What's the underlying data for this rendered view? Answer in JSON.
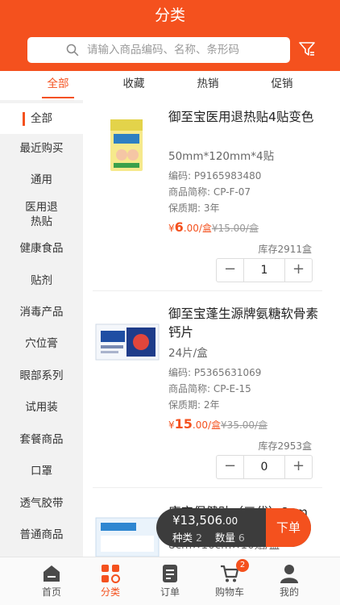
{
  "header": {
    "title": "分类"
  },
  "search": {
    "placeholder": "请输入商品编码、名称、条形码",
    "icon": "search-icon"
  },
  "top_tabs": [
    {
      "label": "全部",
      "active": true
    },
    {
      "label": "收藏"
    },
    {
      "label": "热销"
    },
    {
      "label": "促销"
    }
  ],
  "sidebar": {
    "items": [
      {
        "label": "全部",
        "active": true
      },
      {
        "label": "最近购买"
      },
      {
        "label": "通用"
      },
      {
        "label": "医用退热贴"
      },
      {
        "label": "健康食品"
      },
      {
        "label": "贴剂"
      },
      {
        "label": "消毒产品"
      },
      {
        "label": "穴位膏"
      },
      {
        "label": "眼部系列"
      },
      {
        "label": "试用装"
      },
      {
        "label": "套餐商品"
      },
      {
        "label": "口罩"
      },
      {
        "label": "透气胶带"
      },
      {
        "label": "普通商品"
      }
    ]
  },
  "products": [
    {
      "name": "御至宝医用退热贴4贴变色",
      "spec": "50mm*120mm*4贴",
      "code": "编码: P9165983480",
      "short_name": "商品简称: CP-F-07",
      "shelf_life": "保质期: 3年",
      "price_symbol": "¥",
      "price_int": "6",
      "price_dec": ".00",
      "price_unit": "/盒",
      "old_price": "¥15.00/盒",
      "stock": "库存2911盒",
      "qty": "1"
    },
    {
      "name": "御至宝蓬生源牌氨糖软骨素钙片",
      "spec": "24片/盒",
      "code": "编码: P5365631069",
      "short_name": "商品简称: CP-E-15",
      "shelf_life": "保质期: 2年",
      "price_symbol": "¥",
      "price_int": "15",
      "price_dec": ".00",
      "price_unit": "/盒",
      "old_price": "¥35.00/盒",
      "stock": "库存2953盒",
      "qty": "0"
    },
    {
      "name": "康宝保健贴（三代）8cm",
      "spec": "8cm×10cm×10贴/盒"
    }
  ],
  "cart": {
    "total_symbol": "¥",
    "total_int": "13,506",
    "total_dec": ".00",
    "kinds_label": "种类",
    "kinds_value": "2",
    "qty_label": "数量",
    "qty_value": "6",
    "order_label": "下单"
  },
  "bottom_nav": [
    {
      "label": "首页",
      "icon": "home-icon"
    },
    {
      "label": "分类",
      "icon": "category-icon",
      "active": true
    },
    {
      "label": "订单",
      "icon": "order-icon"
    },
    {
      "label": "购物车",
      "icon": "cart-icon",
      "badge": "2"
    },
    {
      "label": "我的",
      "icon": "profile-icon"
    }
  ],
  "colors": {
    "accent": "#f4511e",
    "cart_bar": "#3c3c3c"
  }
}
